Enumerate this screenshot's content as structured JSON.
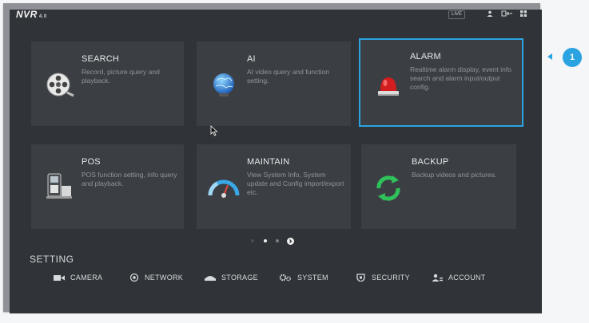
{
  "header": {
    "logo": "NVR",
    "logo_version": "4.0",
    "live_label": "LIVE"
  },
  "tiles": [
    {
      "title": "SEARCH",
      "desc": "Record, picture query and playback.",
      "icon": "film-reel-icon"
    },
    {
      "title": "AI",
      "desc": "AI video query and function setting.",
      "icon": "brain-globe-icon"
    },
    {
      "title": "ALARM",
      "desc": "Realtime alarm display, event info search and alarm input/output config.",
      "icon": "siren-icon",
      "selected": true
    },
    {
      "title": "POS",
      "desc": "POS function setting, info query and playback.",
      "icon": "pos-terminal-icon"
    },
    {
      "title": "MAINTAIN",
      "desc": "View System Info, System update and Config import/export etc.",
      "icon": "gauge-icon"
    },
    {
      "title": "BACKUP",
      "desc": "Backup videos and pictures.",
      "icon": "sync-arrows-icon"
    }
  ],
  "setting": {
    "title": "SETTING",
    "items": [
      {
        "label": "CAMERA",
        "icon": "camera-icon"
      },
      {
        "label": "NETWORK",
        "icon": "network-icon"
      },
      {
        "label": "STORAGE",
        "icon": "storage-icon"
      },
      {
        "label": "SYSTEM",
        "icon": "gear-icon"
      },
      {
        "label": "SECURITY",
        "icon": "shield-icon"
      },
      {
        "label": "ACCOUNT",
        "icon": "account-icon"
      }
    ]
  },
  "callout": {
    "number": "1"
  },
  "colors": {
    "accent": "#2aa3e0",
    "background": "#303438",
    "tile": "#3b3f44"
  }
}
